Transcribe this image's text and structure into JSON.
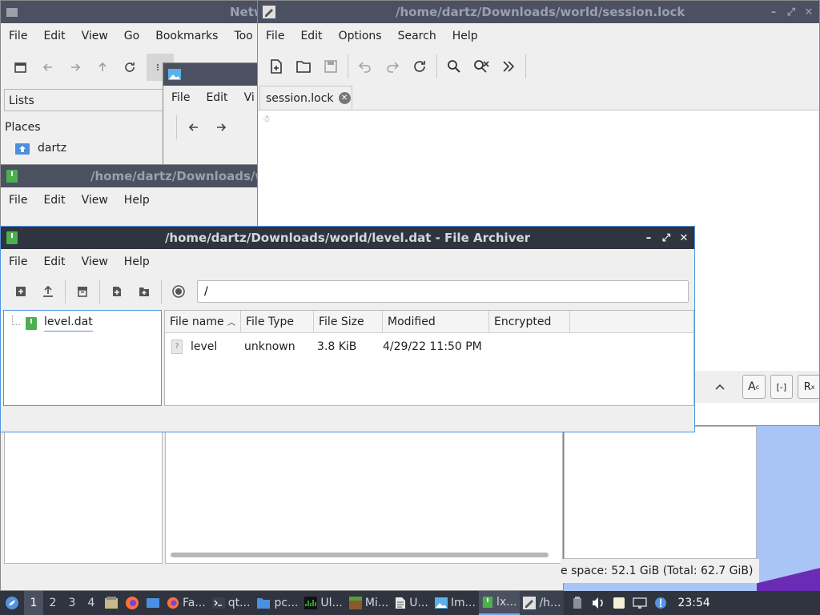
{
  "colors": {
    "titlebar_active": "#2f343f",
    "titlebar_inactive": "#4b5161",
    "desktop": "#a9c4f7",
    "accent": "#5294e2"
  },
  "network_window": {
    "title": "Netw",
    "menu": [
      "File",
      "Edit",
      "View",
      "Go",
      "Bookmarks",
      "Too"
    ],
    "side_tab": "Lists",
    "places_label": "Places",
    "places_item": "dartz"
  },
  "image_window": {
    "menu": [
      "File",
      "Edit",
      "Vi"
    ]
  },
  "editor_window": {
    "title": "/home/dartz/Downloads/world/session.lock",
    "menu": [
      "File",
      "Edit",
      "Options",
      "Search",
      "Help"
    ],
    "tab_label": "session.lock",
    "content_glyph": "☃"
  },
  "archiver_back_window": {
    "title": "/home/dartz/Downloads/w",
    "menu": [
      "File",
      "Edit",
      "View",
      "Help"
    ],
    "status_text": "e space: 52.1 GiB (Total: 62.7 GiB)"
  },
  "archiver_window": {
    "title": "/home/dartz/Downloads/world/level.dat - File Archiver",
    "menu": [
      "File",
      "Edit",
      "View",
      "Help"
    ],
    "location": "/",
    "tree_item": "level.dat",
    "columns": [
      "File name",
      "File Type",
      "File Size",
      "Modified",
      "Encrypted"
    ],
    "rows": [
      {
        "name": "level",
        "type": "unknown",
        "size": "3.8 KiB",
        "modified": "4/29/22 11:50 PM",
        "encrypted": ""
      }
    ]
  },
  "taskbar": {
    "workspaces": [
      "1",
      "2",
      "3",
      "4"
    ],
    "tasks": [
      {
        "label": "Fa...",
        "icon": "firefox-icon"
      },
      {
        "label": "qt...",
        "icon": "terminal-icon"
      },
      {
        "label": "pc...",
        "icon": "folder-icon"
      },
      {
        "label": "Ul...",
        "icon": "system-monitor-icon"
      },
      {
        "label": "Mi...",
        "icon": "minecraft-icon"
      },
      {
        "label": "U...",
        "icon": "document-icon"
      },
      {
        "label": "Im...",
        "icon": "image-viewer-icon"
      },
      {
        "label": "lx...",
        "icon": "archive-icon"
      },
      {
        "label": "/h...",
        "icon": "text-editor-icon"
      }
    ],
    "clock": "23:54"
  }
}
